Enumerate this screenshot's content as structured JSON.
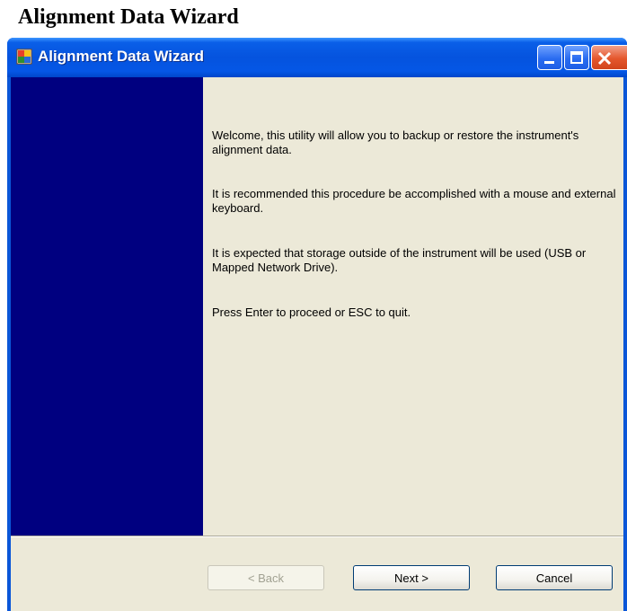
{
  "page": {
    "heading": "Alignment Data Wizard"
  },
  "window": {
    "title": "Alignment Data Wizard",
    "app_icon": "app-icon",
    "controls": [
      "minimize-icon",
      "maximize-icon",
      "close-icon"
    ]
  },
  "content": {
    "paragraphs": [
      "Welcome, this utility will allow you to backup or restore the instrument's alignment data.",
      "It is recommended this procedure be accomplished with a mouse and external keyboard.",
      "It is expected that storage outside of the instrument will be used (USB or Mapped Network Drive).",
      "Press Enter to proceed or ESC to quit."
    ]
  },
  "buttons": {
    "back": "< Back",
    "next": "Next >",
    "cancel": "Cancel"
  },
  "colors": {
    "titlebar": "#0553de",
    "side_panel": "#000080",
    "dialog_background": "#ece9d8",
    "close_button": "#e4572c"
  }
}
